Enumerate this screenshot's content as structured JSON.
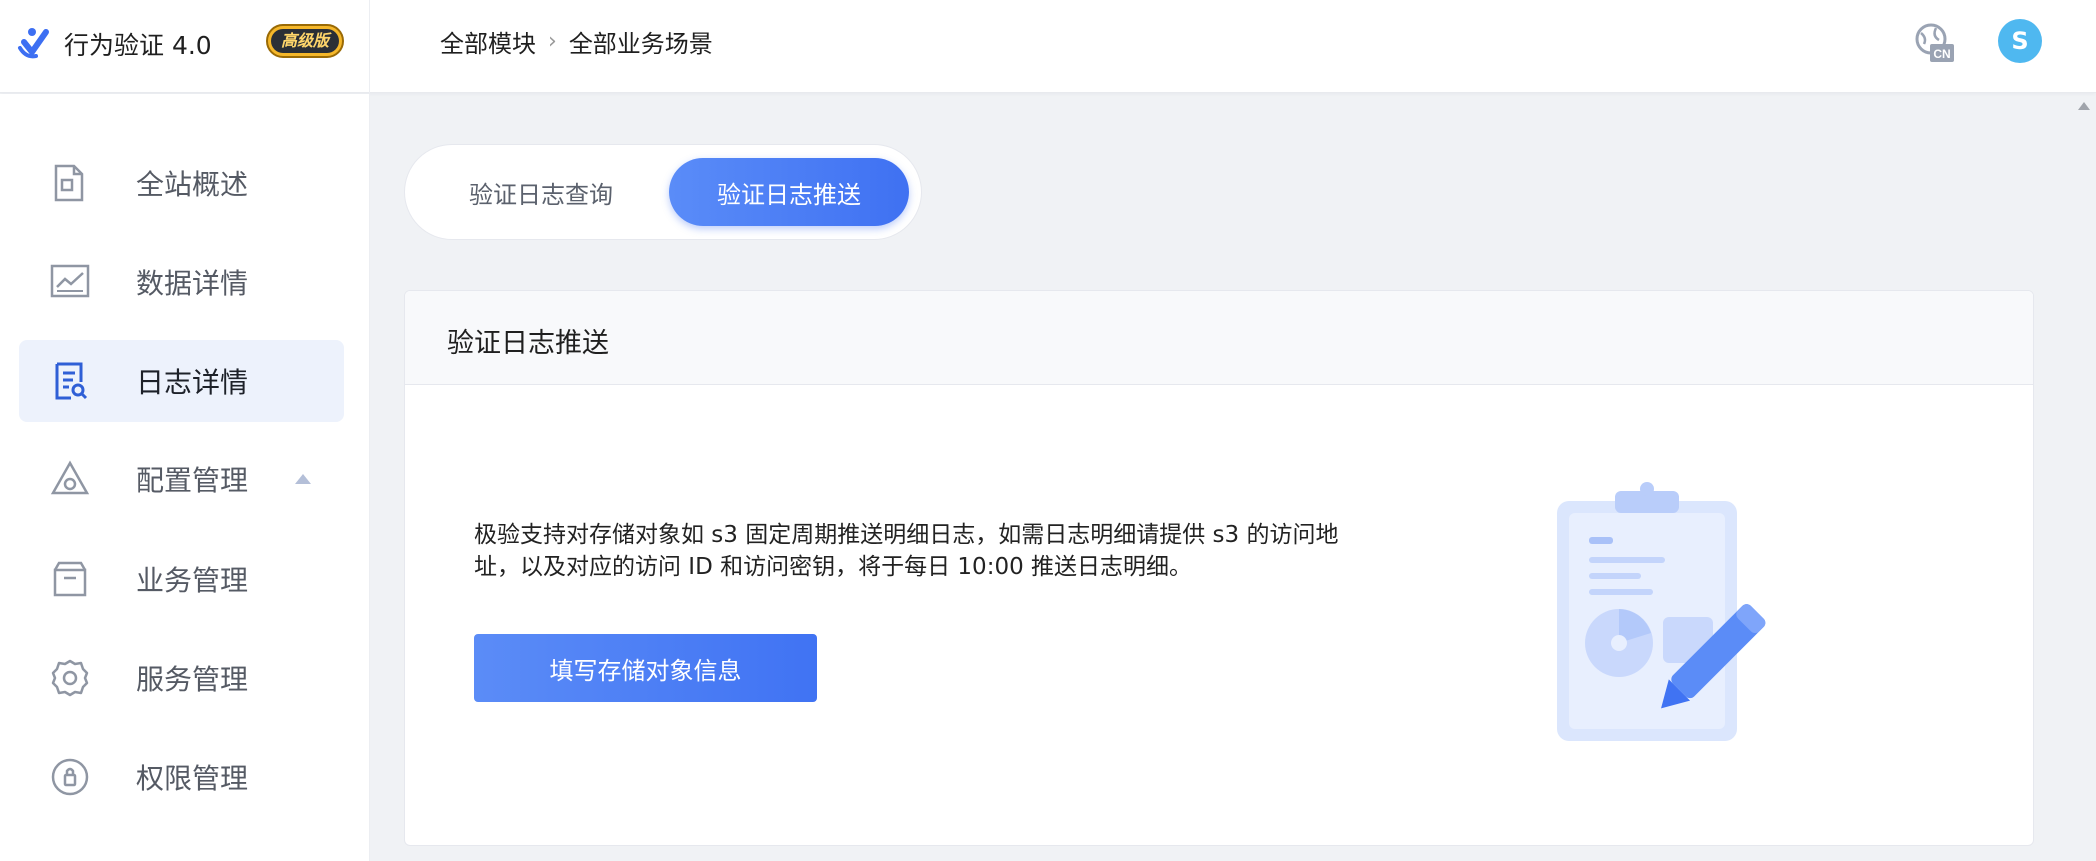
{
  "app": {
    "title": "行为验证 4.0",
    "edition": "高级版",
    "accent_color": "#4073f3"
  },
  "breadcrumb": {
    "items": [
      "全部模块",
      "全部业务场景"
    ],
    "separator_icon": "chevron-right-icon"
  },
  "header": {
    "language_icon": "language-cn-icon",
    "language_label": "CN",
    "avatar_initial": "S"
  },
  "sidebar": {
    "items": [
      {
        "label": "全站概述",
        "icon": "overview-icon",
        "active": false
      },
      {
        "label": "数据详情",
        "icon": "chart-icon",
        "active": false
      },
      {
        "label": "日志详情",
        "icon": "log-search-icon",
        "active": true
      },
      {
        "label": "配置管理",
        "icon": "config-icon",
        "active": false,
        "expandable": true
      },
      {
        "label": "业务管理",
        "icon": "business-icon",
        "active": false
      },
      {
        "label": "服务管理",
        "icon": "gear-icon",
        "active": false
      },
      {
        "label": "权限管理",
        "icon": "lock-icon",
        "active": false
      }
    ]
  },
  "tabs": [
    {
      "label": "验证日志查询",
      "active": false
    },
    {
      "label": "验证日志推送",
      "active": true
    }
  ],
  "card": {
    "title": "验证日志推送",
    "description": "极验支持对存储对象如 s3 固定周期推送明细日志，如需日志明细请提供 s3 的访问地址，以及对应的访问 ID 和访问密钥，将于每日 10:00 推送日志明细。",
    "button_label": "填写存储对象信息",
    "illustration": "clipboard-pencil-illustration"
  }
}
